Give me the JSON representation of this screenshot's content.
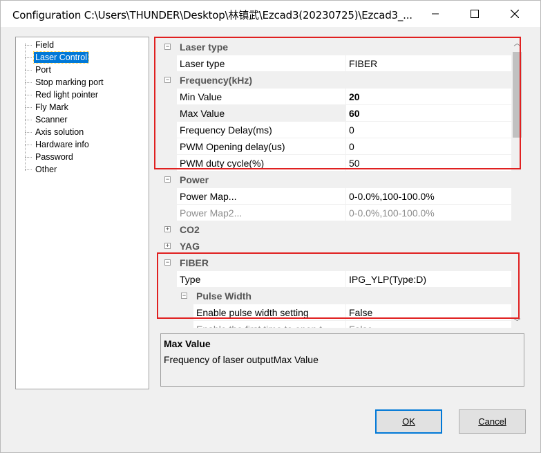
{
  "window": {
    "title": "Configuration C:\\Users\\THUNDER\\Desktop\\林镇武\\Ezcad3(20230725)\\Ezcad3_...",
    "minimize_icon": "minimize-icon",
    "maximize_icon": "maximize-icon",
    "close_icon": "close-icon"
  },
  "tree": {
    "items": [
      {
        "label": "Field"
      },
      {
        "label": "Laser Control"
      },
      {
        "label": "Port"
      },
      {
        "label": "Stop marking port"
      },
      {
        "label": "Red light pointer"
      },
      {
        "label": "Fly Mark"
      },
      {
        "label": "Scanner"
      },
      {
        "label": "Axis solution"
      },
      {
        "label": "Hardware info"
      },
      {
        "label": "Password"
      },
      {
        "label": "Other"
      }
    ],
    "selected": "Laser Control"
  },
  "grid": {
    "rows": [
      {
        "type": "cat",
        "label": "Laser type",
        "exp": "−"
      },
      {
        "type": "prop",
        "name": "Laser type",
        "value": "FIBER"
      },
      {
        "type": "cat",
        "label": "Frequency(kHz)",
        "exp": "−"
      },
      {
        "type": "prop",
        "name": "Min Value",
        "value": "20",
        "bold": true
      },
      {
        "type": "prop",
        "name": "Max Value",
        "value": "60",
        "bold": true
      },
      {
        "type": "prop",
        "name": "Frequency Delay(ms)",
        "value": "0"
      },
      {
        "type": "prop",
        "name": "PWM Opening delay(us)",
        "value": "0"
      },
      {
        "type": "prop",
        "name": "PWM duty cycle(%)",
        "value": "50"
      },
      {
        "type": "cat",
        "label": "Power",
        "exp": "−"
      },
      {
        "type": "prop",
        "name": "Power Map...",
        "value": "0-0.0%,100-100.0%"
      },
      {
        "type": "prop",
        "name": "Power Map2...",
        "value": "0-0.0%,100-100.0%",
        "disabled": true
      },
      {
        "type": "cat",
        "label": "CO2",
        "exp": "+"
      },
      {
        "type": "cat",
        "label": "YAG",
        "exp": "+"
      },
      {
        "type": "cat",
        "label": "FIBER",
        "exp": "−"
      },
      {
        "type": "prop",
        "name": "Type",
        "value": "IPG_YLP(Type:D)"
      },
      {
        "type": "subcat",
        "label": "Pulse Width",
        "exp": "−"
      },
      {
        "type": "prop",
        "name": "Enable pulse width setting",
        "value": "False",
        "indent": true
      },
      {
        "type": "prop",
        "name": "Enable the first time to open t",
        "value": "False",
        "indent": true,
        "disabled": true
      }
    ]
  },
  "description": {
    "title": "Max Value",
    "text": "Frequency of laser outputMax Value"
  },
  "buttons": {
    "ok": "OK",
    "cancel": "Cancel"
  },
  "colors": {
    "highlight_box": "#e02020",
    "selection": "#0078d7"
  }
}
